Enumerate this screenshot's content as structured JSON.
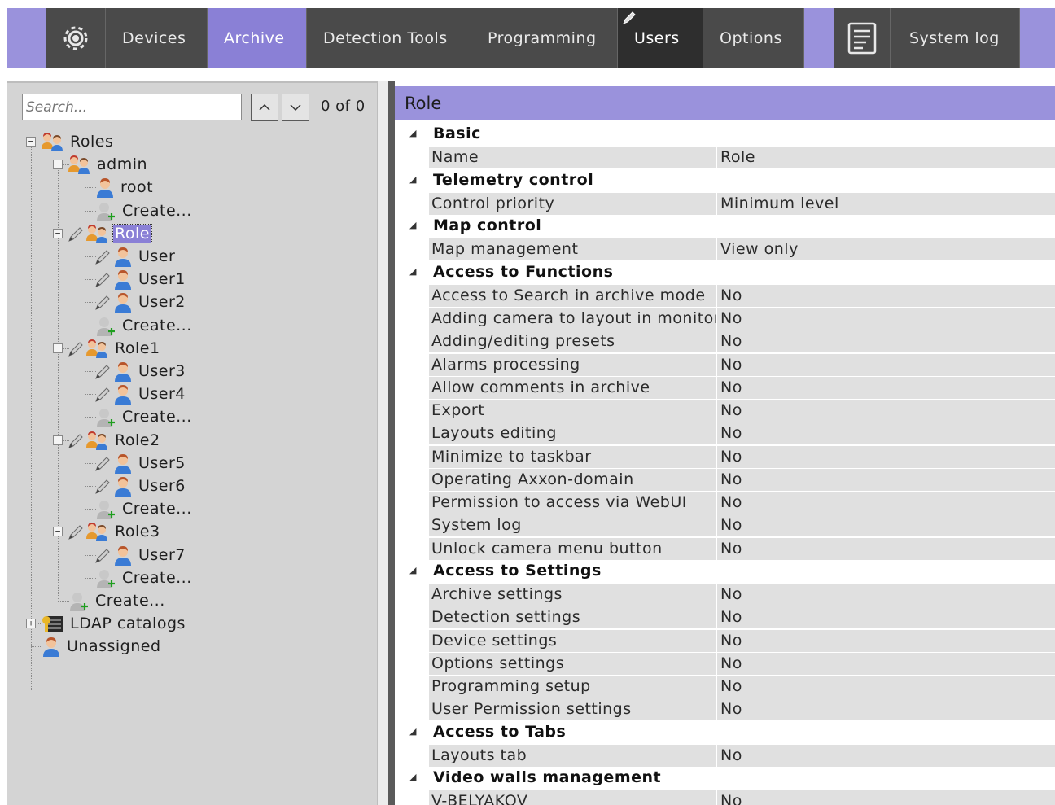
{
  "nav": {
    "items": [
      "Devices",
      "Archive",
      "Detection Tools",
      "Programming",
      "Users",
      "Options"
    ],
    "active": "Archive",
    "current": "Users",
    "system_log": "System log"
  },
  "search": {
    "placeholder": "Search...",
    "count": "0 of 0"
  },
  "tree": [
    {
      "label": "Roles",
      "icon": "roles-icon"
    },
    {
      "label": "admin",
      "icon": "roles-icon"
    },
    {
      "label": "root",
      "icon": "user-icon"
    },
    {
      "label": "Create...",
      "icon": "create-user-icon"
    },
    {
      "label": "Role",
      "icon": "roles-icon",
      "selected": true
    },
    {
      "label": "User",
      "icon": "user-icon"
    },
    {
      "label": "User1",
      "icon": "user-icon"
    },
    {
      "label": "User2",
      "icon": "user-icon"
    },
    {
      "label": "Create...",
      "icon": "create-user-icon"
    },
    {
      "label": "Role1",
      "icon": "roles-icon"
    },
    {
      "label": "User3",
      "icon": "user-icon"
    },
    {
      "label": "User4",
      "icon": "user-icon"
    },
    {
      "label": "Create...",
      "icon": "create-user-icon"
    },
    {
      "label": "Role2",
      "icon": "roles-icon"
    },
    {
      "label": "User5",
      "icon": "user-icon"
    },
    {
      "label": "User6",
      "icon": "user-icon"
    },
    {
      "label": "Create...",
      "icon": "create-user-icon"
    },
    {
      "label": "Role3",
      "icon": "roles-icon"
    },
    {
      "label": "User7",
      "icon": "user-icon"
    },
    {
      "label": "Create...",
      "icon": "create-user-icon"
    },
    {
      "label": "Create...",
      "icon": "create-user-icon"
    },
    {
      "label": "LDAP catalogs",
      "icon": "ldap-icon"
    },
    {
      "label": "Unassigned",
      "icon": "user-icon"
    }
  ],
  "panel": {
    "title": "Role"
  },
  "properties": [
    {
      "group": "Basic"
    },
    {
      "name": "Name",
      "value": "Role"
    },
    {
      "group": "Telemetry control"
    },
    {
      "name": "Control priority",
      "value": "Minimum level"
    },
    {
      "group": "Map control"
    },
    {
      "name": "Map management",
      "value": "View only"
    },
    {
      "group": "Access to Functions"
    },
    {
      "name": "Access to Search in archive mode",
      "value": "No"
    },
    {
      "name": "Adding camera to layout in monitor",
      "value": "No"
    },
    {
      "name": "Adding/editing presets",
      "value": "No"
    },
    {
      "name": "Alarms processing",
      "value": "No"
    },
    {
      "name": "Allow comments in archive",
      "value": "No"
    },
    {
      "name": "Export",
      "value": "No"
    },
    {
      "name": "Layouts editing",
      "value": "No"
    },
    {
      "name": "Minimize to taskbar",
      "value": "No"
    },
    {
      "name": "Operating Axxon-domain",
      "value": "No"
    },
    {
      "name": "Permission to access via WebUI",
      "value": "No"
    },
    {
      "name": "System log",
      "value": "No"
    },
    {
      "name": "Unlock camera menu button",
      "value": "No"
    },
    {
      "group": "Access to Settings"
    },
    {
      "name": "Archive settings",
      "value": "No"
    },
    {
      "name": "Detection settings",
      "value": "No"
    },
    {
      "name": "Device settings",
      "value": "No"
    },
    {
      "name": "Options settings",
      "value": "No"
    },
    {
      "name": "Programming setup",
      "value": "No"
    },
    {
      "name": "User Permission settings",
      "value": "No"
    },
    {
      "group": "Access to Tabs"
    },
    {
      "name": "Layouts tab",
      "value": "No"
    },
    {
      "group": "Video walls management"
    },
    {
      "name": "V-BELYAKOV",
      "value": "No"
    }
  ]
}
